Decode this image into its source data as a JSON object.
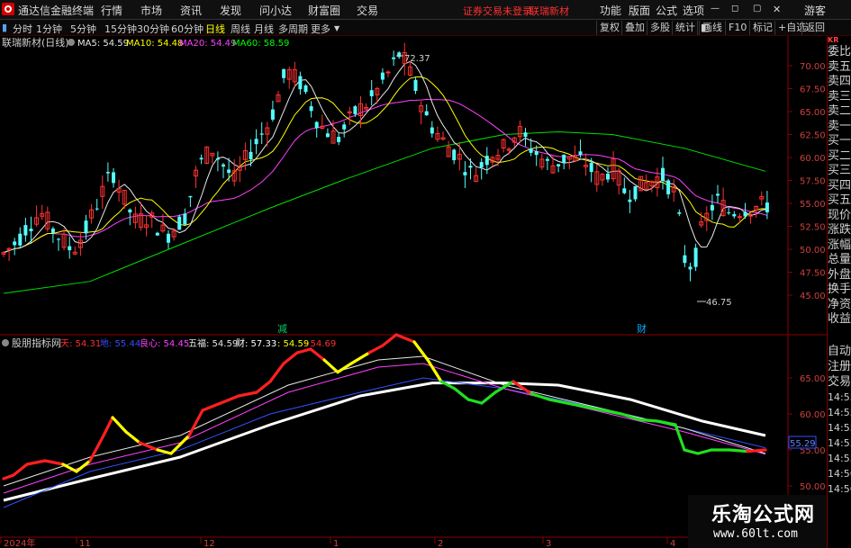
{
  "app": {
    "title": "通达信金融终端"
  },
  "menu": {
    "items": [
      "行情",
      "市场",
      "资讯",
      "发现",
      "问小达",
      "财富圈",
      "交易"
    ],
    "notice": "证券交易未登录",
    "stock_link": "联瑞新材",
    "right_items": [
      "功能",
      "版面",
      "公式",
      "选项"
    ],
    "guest": "游客"
  },
  "toolbar": {
    "periods": [
      "分时",
      "1分钟",
      "5分钟",
      "15分钟",
      "30分钟",
      "60分钟",
      "日线",
      "周线",
      "月线",
      "多周期",
      "更多"
    ],
    "active_period": "日线",
    "right_buttons": [
      "复权",
      "叠加",
      "多股",
      "统计",
      "画线",
      "F10",
      "标记",
      "+自选",
      "返回"
    ]
  },
  "main_chart": {
    "stock": "联瑞新材(日线)",
    "ma": [
      {
        "label": "MA5: 54.59",
        "color": "#e8e8e8"
      },
      {
        "label": "MA10: 54.48",
        "color": "#ffff00"
      },
      {
        "label": "MA20: 54.49",
        "color": "#ff00ff"
      },
      {
        "label": "MA60: 58.59",
        "color": "#00ff00"
      }
    ],
    "y_ticks": [
      "70.00",
      "67.50",
      "65.00",
      "62.50",
      "60.00",
      "57.50",
      "55.00",
      "52.50",
      "50.00",
      "47.50",
      "45.00"
    ],
    "high_label": "72.37",
    "low_label": "46.75",
    "markers": [
      "减",
      "财"
    ]
  },
  "indicator": {
    "name": "股朋指标网",
    "lines": [
      {
        "label": "天: 54.31",
        "color": "#ff3030"
      },
      {
        "label": "地: 55.44",
        "color": "#3050ff"
      },
      {
        "label": "良心: 54.45",
        "color": "#ff40ff"
      },
      {
        "label": "五福: 54.59",
        "color": "#e8e8e8"
      },
      {
        "label": "财: 57.33",
        "color": "#ffffff"
      },
      {
        "label": ": 54.59",
        "color": "#ffff00"
      },
      {
        "label": ": 54.69",
        "color": "#ff3030"
      }
    ],
    "y_ticks": [
      "65.00",
      "60.00",
      "55.00",
      "50.00"
    ],
    "value_box": "55.29"
  },
  "x_axis": [
    "2024年",
    "11",
    "12",
    "1",
    "2",
    "3",
    "4"
  ],
  "right_panel_top": [
    "委比",
    "卖五",
    "卖四",
    "卖三",
    "卖二",
    "卖一",
    "买一",
    "买二",
    "买三",
    "买四",
    "买五",
    "现价",
    "涨跌",
    "涨幅",
    "总量",
    "外盘",
    "换手",
    "净资",
    "收益"
  ],
  "right_panel_bottom": [
    "自动",
    "注册",
    "交易",
    "14:55",
    "14:55",
    "14:55",
    "14:55",
    "14:55",
    "14:56",
    "14:56"
  ],
  "watermark": {
    "title": "乐淘公式网",
    "url": "www.60lt.com"
  }
}
